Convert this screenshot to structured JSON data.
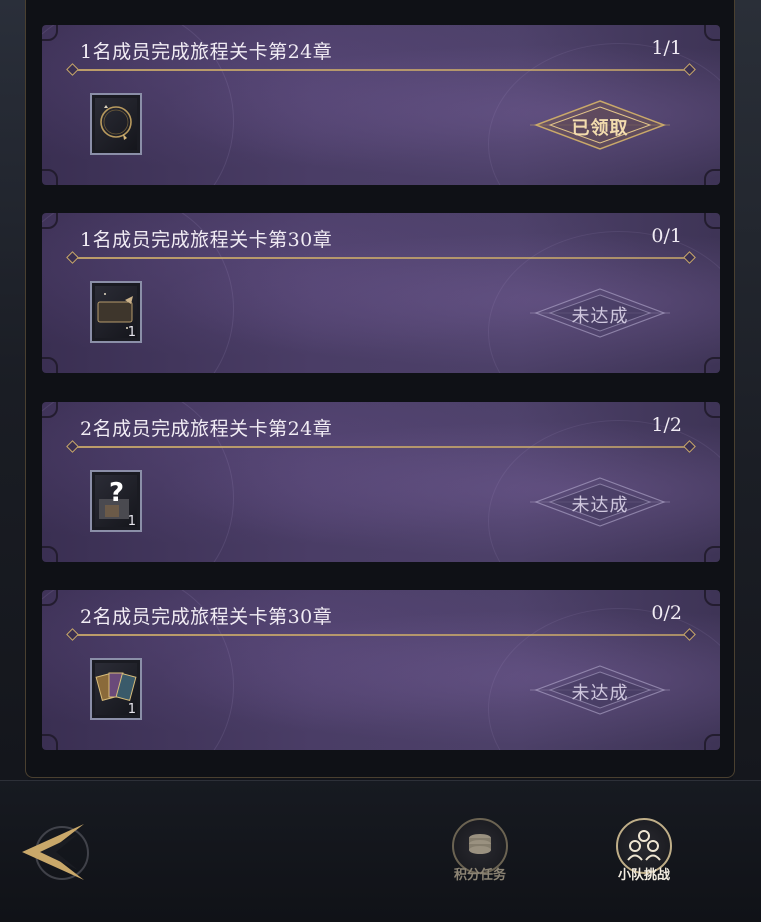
{
  "tasks": [
    {
      "title": "1名成员完成旅程关卡第24章",
      "progress": "1/1",
      "reward_qty": "",
      "reward_icon": "ring-icon",
      "status": "已领取",
      "state": "claimed"
    },
    {
      "title": "1名成员完成旅程关卡第30章",
      "progress": "0/1",
      "reward_qty": "1",
      "reward_icon": "ticket-icon",
      "status": "未达成",
      "state": "pending"
    },
    {
      "title": "2名成员完成旅程关卡第24章",
      "progress": "1/2",
      "reward_qty": "1",
      "reward_icon": "mystery-icon",
      "status": "未达成",
      "state": "pending"
    },
    {
      "title": "2名成员完成旅程关卡第30章",
      "progress": "0/2",
      "reward_qty": "1",
      "reward_icon": "card-pack-icon",
      "status": "未达成",
      "state": "pending"
    }
  ],
  "nav": {
    "back_icon": "back-arrow-icon",
    "points_tasks": {
      "label": "积分任务",
      "icon": "coin-stack-icon"
    },
    "team_challenge": {
      "label": "小队挑战",
      "icon": "team-icon"
    }
  },
  "colors": {
    "gold": "#c9a86a",
    "card_purple": "#453a60",
    "panel": "#0f1116"
  }
}
